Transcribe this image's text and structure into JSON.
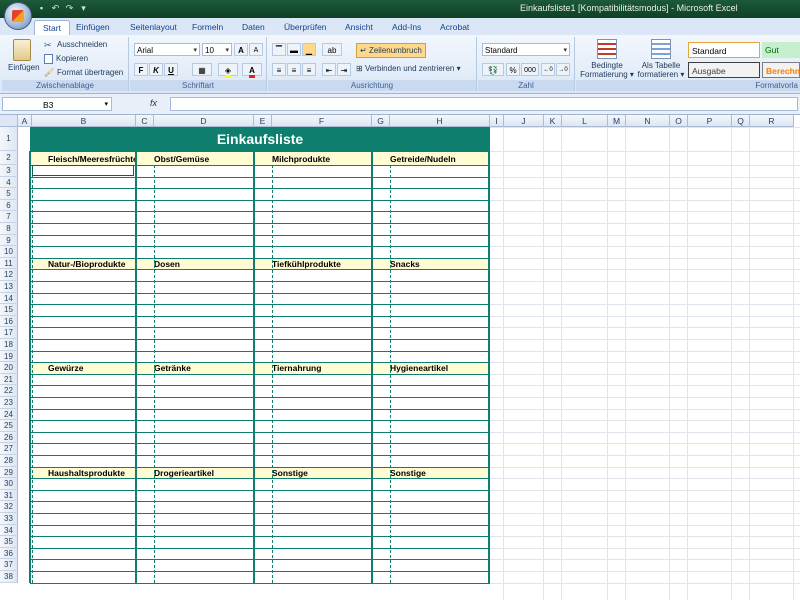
{
  "window": {
    "title": "Einkaufsliste1  [Kompatibilitätsmodus]  -  Microsoft Excel"
  },
  "ribbon_tabs": [
    "Start",
    "Einfügen",
    "Seitenlayout",
    "Formeln",
    "Daten",
    "Überprüfen",
    "Ansicht",
    "Add-Ins",
    "Acrobat"
  ],
  "clipboard": {
    "paste": "Einfügen",
    "cut": "Ausschneiden",
    "copy": "Kopieren",
    "format_painter": "Format übertragen",
    "label": "Zwischenablage"
  },
  "font": {
    "name": "Arial",
    "size": "10",
    "label": "Schriftart",
    "bold": "F",
    "italic": "K",
    "underline": "U"
  },
  "alignment": {
    "wrap": "Zeilenumbruch",
    "merge": "Verbinden und zentrieren",
    "label": "Ausrichtung"
  },
  "number": {
    "format": "Standard",
    "label": "Zahl",
    "percent": "%",
    "thousands": "000"
  },
  "styles": {
    "conditional": "Bedingte\nFormatierung",
    "conditional_line1": "Bedingte",
    "conditional_line2": "Formatierung",
    "as_table_line1": "Als Tabelle",
    "as_table_line2": "formatieren",
    "standard": "Standard",
    "good": "Gut",
    "output": "Ausgabe",
    "calc": "Berechn",
    "label": "Formatvorla"
  },
  "formula_bar": {
    "cell_ref": "B3",
    "fx": "fx",
    "value": ""
  },
  "columns": [
    "A",
    "B",
    "C",
    "D",
    "E",
    "F",
    "G",
    "H",
    "I",
    "J",
    "K",
    "L",
    "M",
    "N",
    "O",
    "P",
    "Q",
    "R"
  ],
  "rows": [
    "1",
    "2",
    "3",
    "4",
    "5",
    "6",
    "7",
    "8",
    "9",
    "10",
    "11",
    "12",
    "13",
    "14",
    "15",
    "16",
    "17",
    "18",
    "19",
    "20",
    "21",
    "22",
    "23",
    "24",
    "25",
    "26",
    "27",
    "28",
    "29",
    "30",
    "31",
    "32",
    "33",
    "34",
    "35",
    "36",
    "37",
    "38"
  ],
  "sheet": {
    "title": "Einkaufsliste",
    "sections": [
      {
        "row": 2,
        "categories": [
          "Fleisch/Meeresfrüchte",
          "Obst/Gemüse",
          "Milchprodukte",
          "Getreide/Nudeln"
        ]
      },
      {
        "row": 11,
        "categories": [
          "Natur-/Bioprodukte",
          "Dosen",
          "Tiefkühlprodukte",
          "Snacks"
        ]
      },
      {
        "row": 20,
        "categories": [
          "Gewürze",
          "Getränke",
          "Tiernahrung",
          "Hygieneartikel"
        ]
      },
      {
        "row": 29,
        "categories": [
          "Haushaltsprodukte",
          "Drogerieartikel",
          "Sonstige",
          "Sonstige"
        ]
      }
    ]
  },
  "colors": {
    "title_bg": "#0e7f6e",
    "category_bg": "#fffbd2",
    "window_bar": "#1c5a39"
  }
}
